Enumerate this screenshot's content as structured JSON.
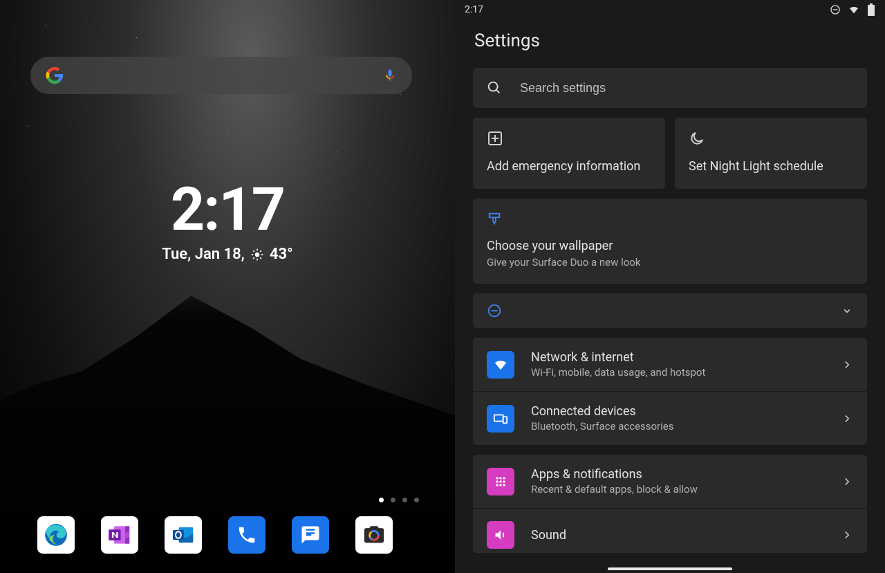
{
  "home": {
    "clock": "2:17",
    "date_prefix": "Tue, Jan 18,",
    "temperature": "43°",
    "search": {
      "placeholder": ""
    },
    "dock": [
      {
        "name": "edge"
      },
      {
        "name": "onenote"
      },
      {
        "name": "outlook"
      },
      {
        "name": "phone"
      },
      {
        "name": "messages"
      },
      {
        "name": "camera"
      }
    ],
    "page_count": 4,
    "active_page": 0
  },
  "statusbar": {
    "time": "2:17"
  },
  "settings": {
    "title": "Settings",
    "search_placeholder": "Search settings",
    "suggestions": {
      "emergency": "Add emergency information",
      "nightlight": "Set Night Light schedule",
      "wallpaper_title": "Choose your wallpaper",
      "wallpaper_sub": "Give your Surface Duo a new look"
    },
    "items": [
      {
        "title": "Network & internet",
        "sub": "Wi-Fi, mobile, data usage, and hotspot",
        "icon": "wifi",
        "color": "blue"
      },
      {
        "title": "Connected devices",
        "sub": "Bluetooth, Surface accessories",
        "icon": "devices",
        "color": "blue"
      },
      {
        "title": "Apps & notifications",
        "sub": "Recent & default apps, block & allow",
        "icon": "apps",
        "color": "pink"
      },
      {
        "title": "Sound",
        "sub": "",
        "icon": "sound",
        "color": "pink"
      }
    ]
  }
}
